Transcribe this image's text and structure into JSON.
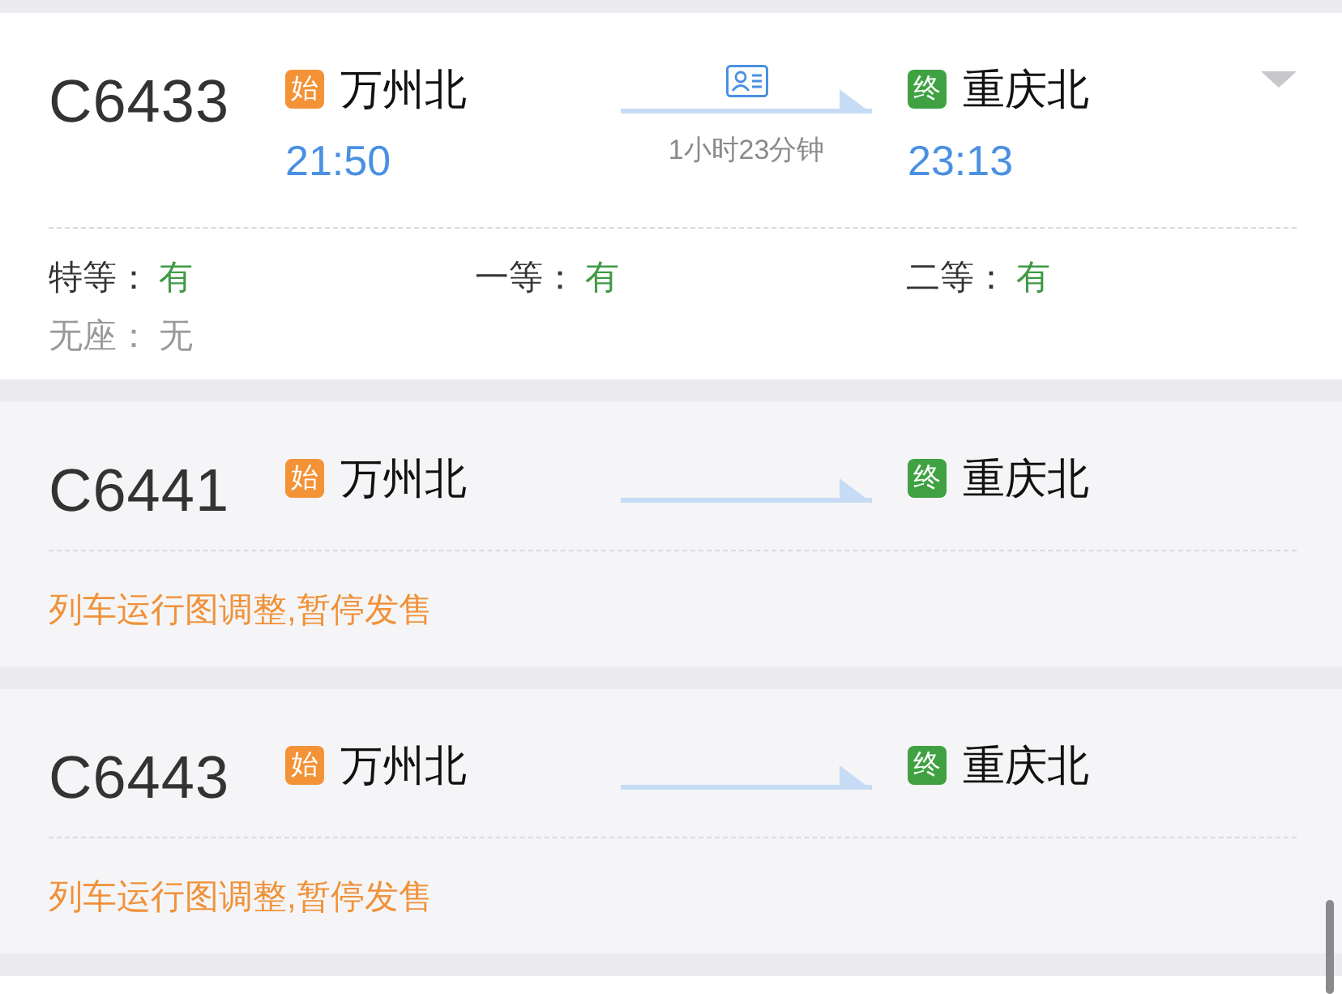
{
  "trains": [
    {
      "kind": "bookable",
      "number": "C6433",
      "id_card": true,
      "from": {
        "badge": "始",
        "station": "万州北",
        "time": "21:50"
      },
      "to": {
        "badge": "终",
        "station": "重庆北",
        "time": "23:13"
      },
      "duration": "1小时23分钟",
      "seats": [
        {
          "label": "特等：",
          "value": "有",
          "available": true
        },
        {
          "label": "一等：",
          "value": "有",
          "available": true
        },
        {
          "label": "二等：",
          "value": "有",
          "available": true
        },
        {
          "label": "无座：",
          "value": "无",
          "available": false
        }
      ]
    },
    {
      "kind": "suspended",
      "number": "C6441",
      "id_card": false,
      "from": {
        "badge": "始",
        "station": "万州北"
      },
      "to": {
        "badge": "终",
        "station": "重庆北"
      },
      "notice": "列车运行图调整,暂停发售"
    },
    {
      "kind": "suspended",
      "number": "C6443",
      "id_card": false,
      "from": {
        "badge": "始",
        "station": "万州北"
      },
      "to": {
        "badge": "终",
        "station": "重庆北"
      },
      "notice": "列车运行图调整,暂停发售"
    }
  ]
}
